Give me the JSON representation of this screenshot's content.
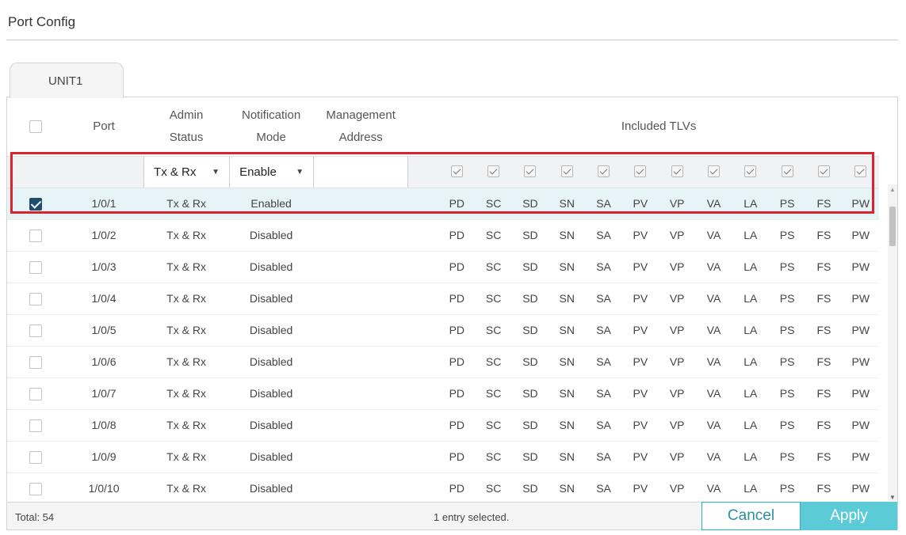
{
  "page": {
    "title": "Port Config"
  },
  "tabs": [
    {
      "label": "UNIT1",
      "active": true
    }
  ],
  "table": {
    "headers": {
      "port": "Port",
      "admin_status_line1": "Admin",
      "admin_status_line2": "Status",
      "notification_mode_line1": "Notification",
      "notification_mode_line2": "Mode",
      "management_address_line1": "Management",
      "management_address_line2": "Address",
      "included_tlvs": "Included TLVs"
    },
    "filter_row": {
      "admin_status_value": "Tx & Rx",
      "notification_mode_value": "Enable",
      "management_address_value": "",
      "tlv_checkboxes_checked": true
    },
    "tlv_columns": [
      "PD",
      "SC",
      "SD",
      "SN",
      "SA",
      "PV",
      "VP",
      "VA",
      "LA",
      "PS",
      "FS",
      "PW"
    ],
    "rows": [
      {
        "port": "1/0/1",
        "admin_status": "Tx & Rx",
        "notification_mode": "Enabled",
        "checked": true
      },
      {
        "port": "1/0/2",
        "admin_status": "Tx & Rx",
        "notification_mode": "Disabled",
        "checked": false
      },
      {
        "port": "1/0/3",
        "admin_status": "Tx & Rx",
        "notification_mode": "Disabled",
        "checked": false
      },
      {
        "port": "1/0/4",
        "admin_status": "Tx & Rx",
        "notification_mode": "Disabled",
        "checked": false
      },
      {
        "port": "1/0/5",
        "admin_status": "Tx & Rx",
        "notification_mode": "Disabled",
        "checked": false
      },
      {
        "port": "1/0/6",
        "admin_status": "Tx & Rx",
        "notification_mode": "Disabled",
        "checked": false
      },
      {
        "port": "1/0/7",
        "admin_status": "Tx & Rx",
        "notification_mode": "Disabled",
        "checked": false
      },
      {
        "port": "1/0/8",
        "admin_status": "Tx & Rx",
        "notification_mode": "Disabled",
        "checked": false
      },
      {
        "port": "1/0/9",
        "admin_status": "Tx & Rx",
        "notification_mode": "Disabled",
        "checked": false
      },
      {
        "port": "1/0/10",
        "admin_status": "Tx & Rx",
        "notification_mode": "Disabled",
        "checked": false
      }
    ]
  },
  "footer": {
    "total": "Total: 54",
    "selected_info": "1 entry selected.",
    "cancel_label": "Cancel",
    "apply_label": "Apply"
  },
  "colors": {
    "accent": "#5ccbd8",
    "accent_border": "#2bb3c7",
    "checkbox_checked": "#1e4e6e",
    "highlight": "#d9232d",
    "selected_row": "#e6f3f7"
  },
  "icons": {
    "dropdown": "caret-down-icon",
    "scroll_up": "scroll-up-arrow-icon",
    "scroll_down": "scroll-down-arrow-icon"
  }
}
